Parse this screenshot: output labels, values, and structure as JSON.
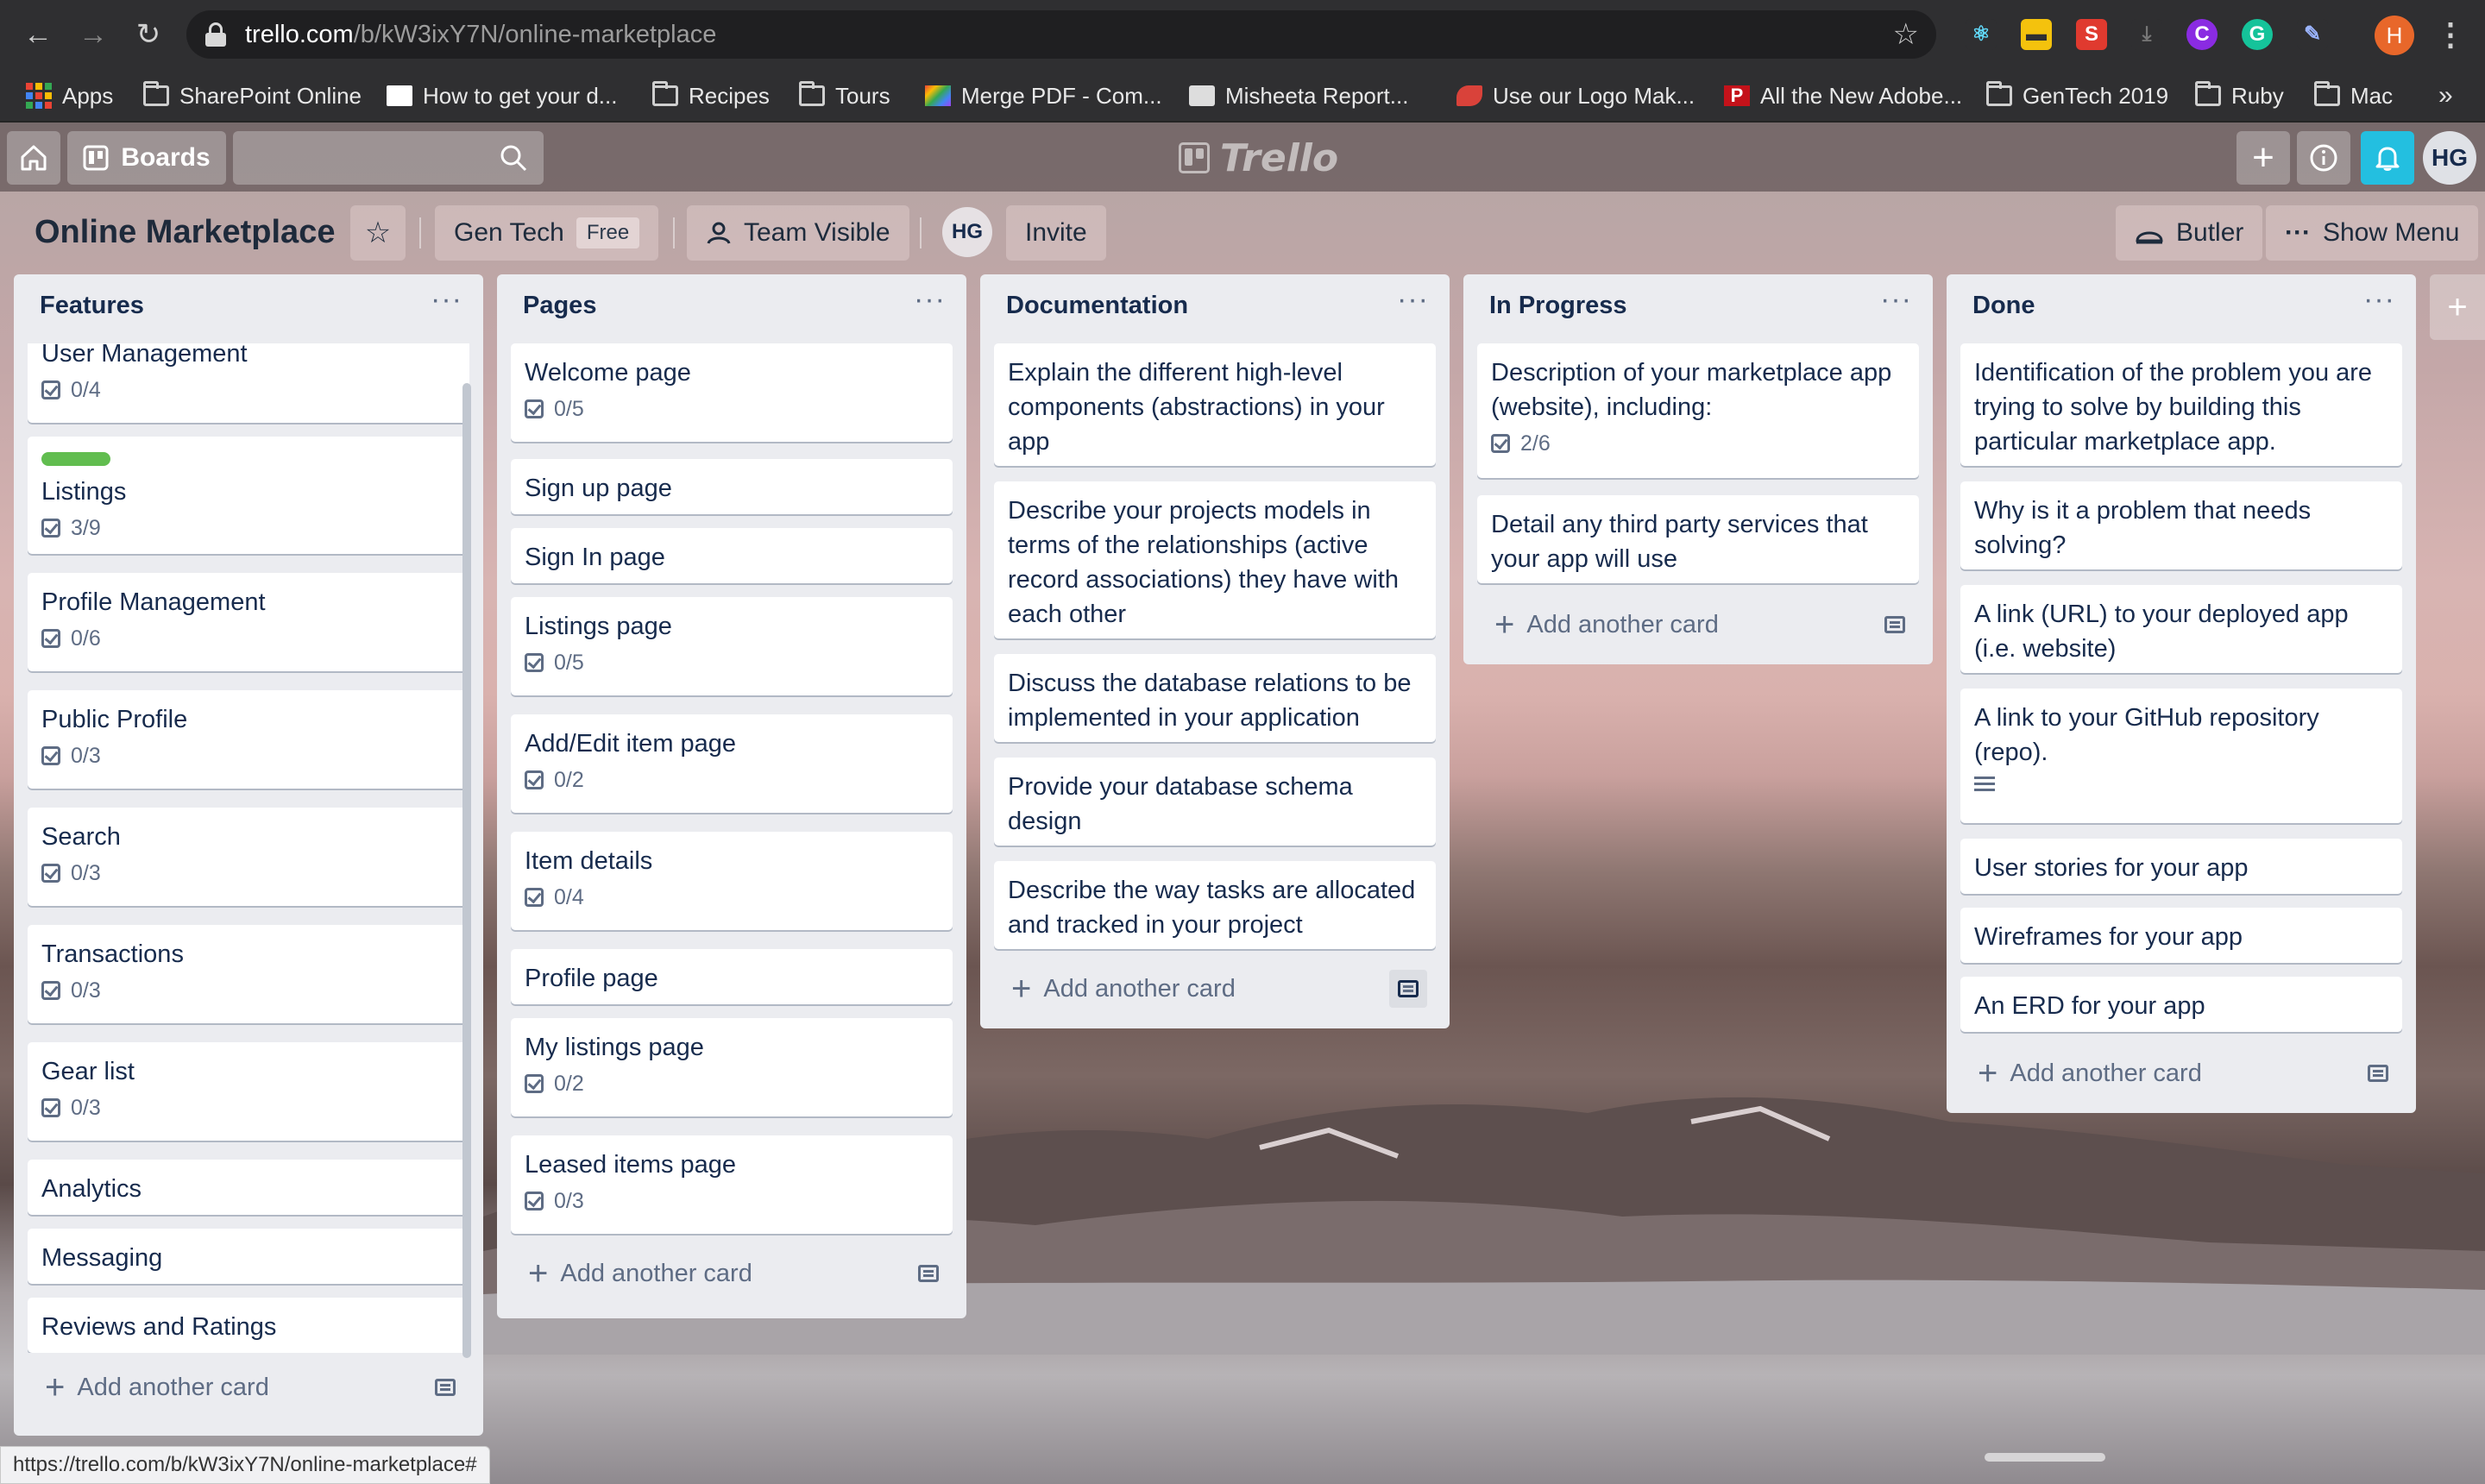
{
  "browser": {
    "url_host": "trello.com",
    "url_path": "/b/kW3ixY7N/online-marketplace",
    "status_url": "https://trello.com/b/kW3ixY7N/online-marketplace#",
    "profile_initial": "H",
    "bookmarks": [
      {
        "label": "Apps",
        "icon": "apps-grid-icon"
      },
      {
        "label": "SharePoint Online",
        "icon": "folder-icon"
      },
      {
        "label": "How to get your d...",
        "icon": "page-icon"
      },
      {
        "label": "Recipes",
        "icon": "folder-icon"
      },
      {
        "label": "Tours",
        "icon": "folder-icon"
      },
      {
        "label": "Merge PDF - Com...",
        "icon": "colorful-page-icon"
      },
      {
        "label": "Misheeta Report...",
        "icon": "report-icon"
      },
      {
        "label": "Use our Logo Mak...",
        "icon": "logo-maker-icon"
      },
      {
        "label": "All the New Adobe...",
        "icon": "p-icon"
      },
      {
        "label": "GenTech 2019",
        "icon": "folder-icon"
      },
      {
        "label": "Ruby",
        "icon": "folder-icon"
      },
      {
        "label": "Mac",
        "icon": "folder-icon"
      }
    ],
    "bookmarks_overflow": "»",
    "extensions": [
      {
        "name": "react-devtools-icon",
        "glyph": "⚛",
        "color": "#2f2f31",
        "fg": "#61dafb"
      },
      {
        "name": "notes-extension-icon",
        "glyph": "▬",
        "color": "#f4c20d",
        "fg": "#2f2f31"
      },
      {
        "name": "s-extension-icon",
        "glyph": "S",
        "color": "#e03a2f",
        "fg": "#ffffff"
      },
      {
        "name": "download-extension-icon",
        "glyph": "⤓",
        "color": "#2f2f31",
        "fg": "#777777"
      },
      {
        "name": "c-extension-icon",
        "glyph": "C",
        "color": "#8a2be2",
        "fg": "#ffffff"
      },
      {
        "name": "grammarly-icon",
        "glyph": "G",
        "color": "#15c39a",
        "fg": "#ffffff"
      },
      {
        "name": "eyedropper-icon",
        "glyph": "✎",
        "color": "#2f2f31",
        "fg": "#9bb4ff"
      }
    ]
  },
  "trello_header": {
    "boards_label": "Boards",
    "logo_text": "Trello",
    "member_initials": "HG"
  },
  "board": {
    "title": "Online Marketplace",
    "team": "Gen Tech",
    "team_plan": "Free",
    "visibility": "Team Visible",
    "member_initials": "HG",
    "invite_label": "Invite",
    "butler_label": "Butler",
    "show_menu_label": "Show Menu"
  },
  "add_card_label": "Add another card",
  "lists": [
    {
      "title": "Features",
      "cards": [
        {
          "title": "User Management",
          "checklist": "0/4"
        },
        {
          "title": "Listings",
          "checklist": "3/9",
          "label_color": "#61bd4f"
        },
        {
          "title": "Profile Management",
          "checklist": "0/6"
        },
        {
          "title": "Public Profile",
          "checklist": "0/3"
        },
        {
          "title": "Search",
          "checklist": "0/3"
        },
        {
          "title": "Transactions",
          "checklist": "0/3"
        },
        {
          "title": "Gear list",
          "checklist": "0/3"
        },
        {
          "title": "Analytics"
        },
        {
          "title": "Messaging"
        },
        {
          "title": "Reviews and Ratings"
        }
      ]
    },
    {
      "title": "Pages",
      "cards": [
        {
          "title": "Welcome page",
          "checklist": "0/5"
        },
        {
          "title": "Sign up page"
        },
        {
          "title": "Sign In page"
        },
        {
          "title": "Listings page",
          "checklist": "0/5"
        },
        {
          "title": "Add/Edit item page",
          "checklist": "0/2"
        },
        {
          "title": "Item details",
          "checklist": "0/4"
        },
        {
          "title": "Profile page"
        },
        {
          "title": "My listings page",
          "checklist": "0/2"
        },
        {
          "title": "Leased items page",
          "checklist": "0/3"
        }
      ]
    },
    {
      "title": "Documentation",
      "cards": [
        {
          "title": "Explain the different high-level components (abstractions) in your app"
        },
        {
          "title": "Describe your projects models in terms of the relationships (active record associations) they have with each other"
        },
        {
          "title": "Discuss the database relations to be implemented in your application"
        },
        {
          "title": "Provide your database schema design"
        },
        {
          "title": "Describe the way tasks are allocated and tracked in your project"
        }
      ]
    },
    {
      "title": "In Progress",
      "cards": [
        {
          "title": "Description of your marketplace app (website), including:",
          "checklist": "2/6"
        },
        {
          "title": "Detail any third party services that your app will use"
        }
      ]
    },
    {
      "title": "Done",
      "cards": [
        {
          "title": "Identification of the problem you are trying to solve by building this particular marketplace app."
        },
        {
          "title": "Why is it a problem that needs solving?"
        },
        {
          "title": "A link (URL) to your deployed app (i.e. website)"
        },
        {
          "title": "A link to your GitHub repository (repo).",
          "has_description": true
        },
        {
          "title": "User stories for your app"
        },
        {
          "title": "Wireframes for your app"
        },
        {
          "title": "An ERD for your app"
        }
      ]
    }
  ]
}
